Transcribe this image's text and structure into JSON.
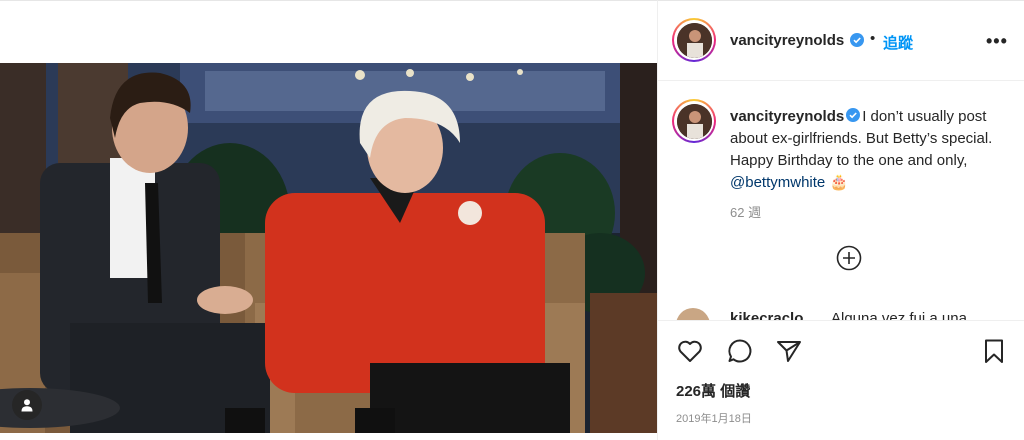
{
  "post": {
    "username": "vancityreynolds",
    "separator": "•",
    "follow_label": "追蹤",
    "more_label": "•••",
    "caption_text": "I don’t usually post about ex-girlfriends. But Betty’s special. Happy Birthday to the one and only, ",
    "mention": "@bettymwhite",
    "emoji": "🎂",
    "time_ago": "62 週",
    "next_comment_user": "kikecraclo",
    "next_comment_text": "Alguna vez fui a una",
    "likes": "226萬 個讚",
    "date": "2019年1月18日"
  },
  "icons": {
    "verified": "verified-badge-icon",
    "more": "more-options-icon",
    "load_more": "plus-circle-icon",
    "like": "heart-icon",
    "comment": "comment-bubble-icon",
    "share": "paper-plane-icon",
    "save": "bookmark-icon",
    "tag": "user-tag-icon"
  },
  "colors": {
    "link": "#0095f6",
    "mention": "#00376b",
    "text": "#262626",
    "muted": "#8e8e8e",
    "verified": "#3897f0"
  }
}
